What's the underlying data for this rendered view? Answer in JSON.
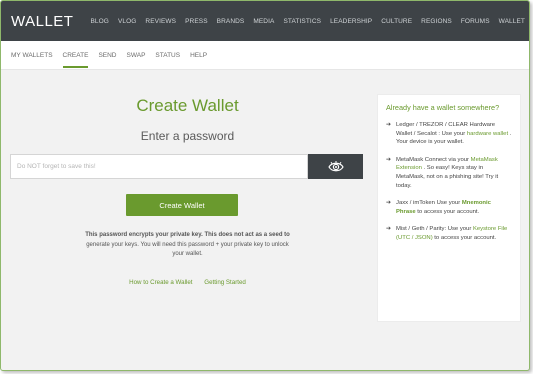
{
  "header": {
    "brand": "WALLET",
    "nav": [
      "BLOG",
      "VLOG",
      "REVIEWS",
      "PRESS",
      "BRANDS",
      "MEDIA",
      "STATISTICS",
      "LEADERSHIP",
      "CULTURE",
      "REGIONS",
      "FORUMS",
      "WALLET"
    ]
  },
  "subnav": [
    "MY WALLETS",
    "CREATE",
    "SEND",
    "SWAP",
    "STATUS",
    "HELP"
  ],
  "main": {
    "title": "Create Wallet",
    "subtitle": "Enter a password",
    "password_placeholder": "Do NOT forget to save this!",
    "password_value": "",
    "create_button": "Create Wallet",
    "note_line1": "This password encrypts your private key. This does not act as a seed to",
    "note_line2": "generate your keys. You will need this password + your private key to unlock",
    "note_line3": "your wallet.",
    "link_how": "How to Create a Wallet",
    "link_started": "Getting Started"
  },
  "sidebar": {
    "title": "Already have a wallet somewhere?",
    "items": [
      {
        "pre": "Ledger / TREZOR / CLEAR Hardware Wallet / Secalot : Use your ",
        "hl": "hardware wallet",
        "post": " . Your device is your wallet."
      },
      {
        "pre": "MetaMask Connect via your ",
        "hl": "MetaMask Extension",
        "post": " . So easy! Keys stay in MetaMask, not on a phishing site! Try it today."
      },
      {
        "pre": "Jaxx / imToken Use your ",
        "hl": "Mnemonic Phrase",
        "post": " to access your account."
      },
      {
        "pre": "Mist / Geth / Parity: Use your ",
        "hl": "Keystore File (UTC / JSON)",
        "post": " to access your account."
      }
    ]
  },
  "icons": {
    "eye": "eye-icon",
    "arrow": "arrow-right-icon"
  },
  "colors": {
    "accent": "#6a9a2e",
    "topbar": "#3e4347",
    "page_bg": "#f2f2f2"
  }
}
